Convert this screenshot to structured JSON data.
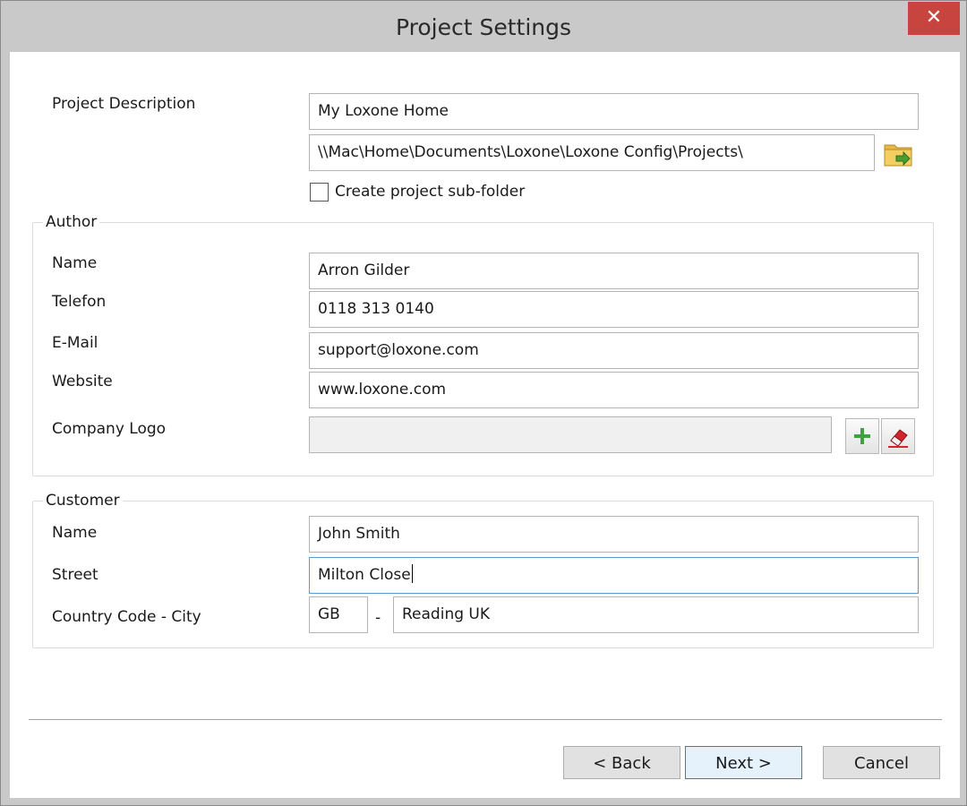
{
  "window": {
    "title": "Project Settings",
    "close_glyph": "✕"
  },
  "project": {
    "description_label": "Project Description",
    "description_value": "My Loxone Home",
    "path_value": "\\\\Mac\\Home\\Documents\\Loxone\\Loxone Config\\Projects\\",
    "subfolder_label": "Create project sub-folder",
    "subfolder_checked": false
  },
  "author": {
    "group_title": "Author",
    "name_label": "Name",
    "name_value": "Arron Gilder",
    "phone_label": "Telefon",
    "phone_value": "0118 313 0140",
    "email_label": "E-Mail",
    "email_value": "support@loxone.com",
    "website_label": "Website",
    "website_value": "www.loxone.com",
    "logo_label": "Company Logo",
    "logo_value": ""
  },
  "customer": {
    "group_title": "Customer",
    "name_label": "Name",
    "name_value": "John Smith",
    "street_label": "Street",
    "street_value": "Milton Close",
    "city_label": "Country Code - City",
    "country_code_value": "GB",
    "dash": "-",
    "city_value": "Reading UK"
  },
  "footer": {
    "back_label": "< Back",
    "next_label": "Next >",
    "cancel_label": "Cancel"
  },
  "icons": {
    "browse_folder": "folder-arrow-icon",
    "add_logo": "plus-icon",
    "clear_logo": "eraser-icon"
  },
  "colors": {
    "close_button": "#c7443f",
    "focus_border": "#5a9bd5",
    "default_button_border": "#3c7fb1",
    "plus_icon": "#3da33d",
    "eraser_red": "#d3252b"
  }
}
